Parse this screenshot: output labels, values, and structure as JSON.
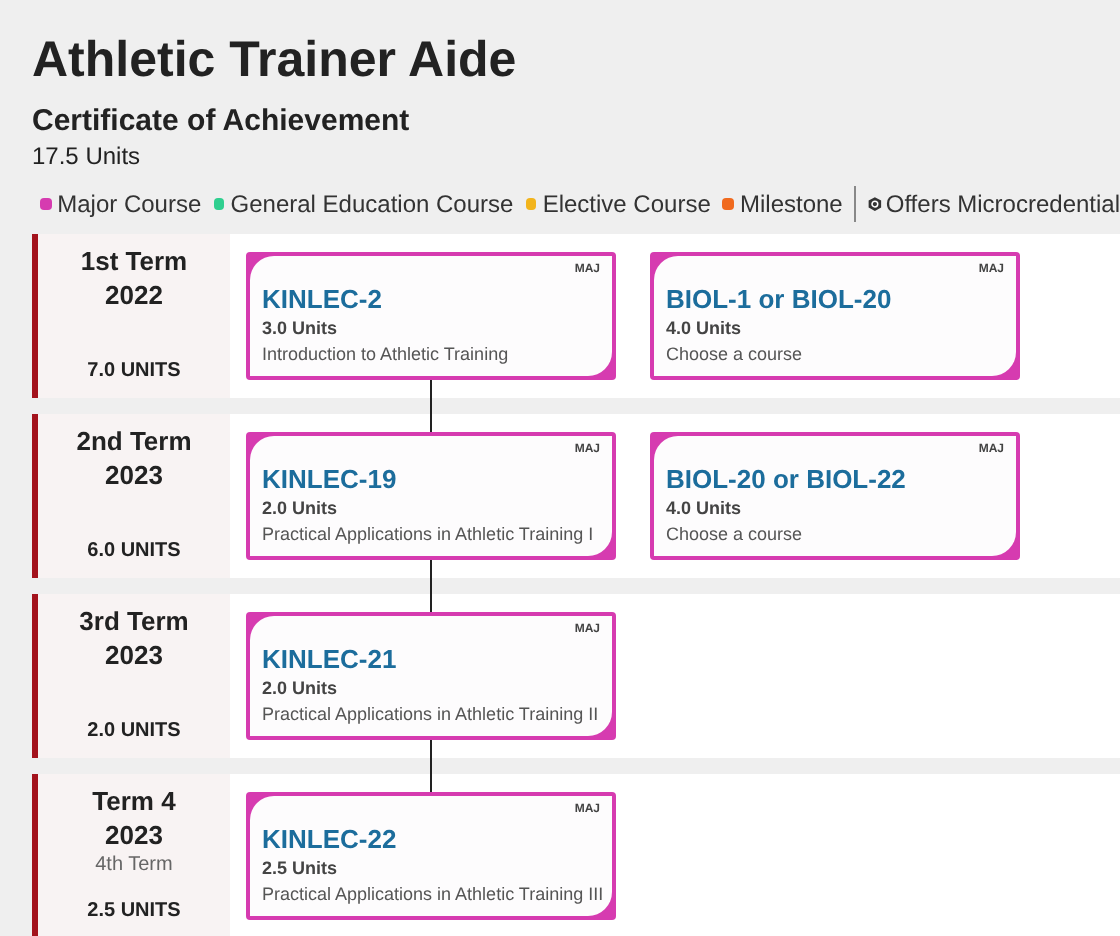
{
  "title": "Athletic Trainer Aide",
  "subtitle": "Certificate of Achievement",
  "units": "17.5 Units",
  "legend": [
    {
      "label": "Major Course",
      "color": "#d63bb0"
    },
    {
      "label": "General Education Course",
      "color": "#2fcf8f"
    },
    {
      "label": "Elective Course",
      "color": "#f2b41c"
    },
    {
      "label": "Milestone",
      "color": "#f06a1e"
    }
  ],
  "microcredential_label": "Offers Microcredential",
  "terms": [
    {
      "name": "1st Term",
      "year": "2022",
      "units": "7.0 UNITS",
      "courses": [
        {
          "kind": "major",
          "badge": "MAJ",
          "code": "KINLEC-2",
          "units": "3.0 Units",
          "title": "Introduction to Athletic Training"
        },
        {
          "kind": "major",
          "badge": "MAJ",
          "code": "BIOL-1 or BIOL-20",
          "units": "4.0 Units",
          "title": "Choose a course"
        }
      ]
    },
    {
      "name": "2nd Term",
      "year": "2023",
      "units": "6.0 UNITS",
      "courses": [
        {
          "kind": "major",
          "badge": "MAJ",
          "code": "KINLEC-19",
          "units": "2.0 Units",
          "title": "Practical Applications in Athletic Training I"
        },
        {
          "kind": "major",
          "badge": "MAJ",
          "code": "BIOL-20 or BIOL-22",
          "units": "4.0 Units",
          "title": "Choose a course"
        }
      ]
    },
    {
      "name": "3rd Term",
      "year": "2023",
      "units": "2.0 UNITS",
      "courses": [
        {
          "kind": "major",
          "badge": "MAJ",
          "code": "KINLEC-21",
          "units": "2.0 Units",
          "title": "Practical Applications in Athletic Training II"
        }
      ]
    },
    {
      "name": "Term 4",
      "year": "2023",
      "note": "4th Term",
      "units": "2.5 UNITS",
      "courses": [
        {
          "kind": "major",
          "badge": "MAJ",
          "code": "KINLEC-22",
          "units": "2.5 Units",
          "title": "Practical Applications in Athletic Training III"
        }
      ]
    }
  ]
}
